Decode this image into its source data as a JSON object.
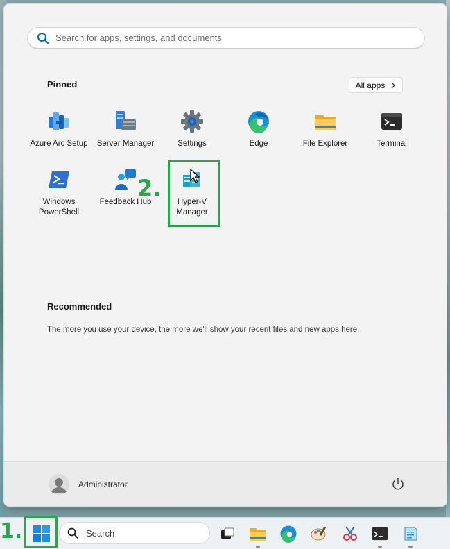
{
  "search": {
    "placeholder": "Search for apps, settings, and documents"
  },
  "pinned": {
    "title": "Pinned",
    "all_apps_label": "All apps",
    "apps": [
      {
        "label": "Azure Arc Setup",
        "icon": "azure-arc-icon"
      },
      {
        "label": "Server Manager",
        "icon": "server-manager-icon"
      },
      {
        "label": "Settings",
        "icon": "gear-icon"
      },
      {
        "label": "Edge",
        "icon": "edge-icon"
      },
      {
        "label": "File Explorer",
        "icon": "folder-icon"
      },
      {
        "label": "Terminal",
        "icon": "terminal-icon"
      },
      {
        "label": "Windows PowerShell",
        "icon": "powershell-icon"
      },
      {
        "label": "Feedback Hub",
        "icon": "feedback-hub-icon"
      },
      {
        "label": "Hyper-V Manager",
        "icon": "hyper-v-icon"
      }
    ]
  },
  "recommended": {
    "title": "Recommended",
    "empty_text": "The more you use your device, the more we'll show your recent files and new apps here."
  },
  "footer": {
    "user_name": "Administrator"
  },
  "taskbar": {
    "search_label": "Search",
    "icons": [
      "task-view-icon",
      "file-explorer-icon",
      "edge-icon",
      "paint-icon",
      "snipping-tool-icon",
      "terminal-icon",
      "notepad-icon"
    ]
  },
  "annotations": {
    "step1": "1.",
    "step2": "2."
  },
  "colors": {
    "highlight": "#2aa74a",
    "accent": "#0067c0"
  }
}
